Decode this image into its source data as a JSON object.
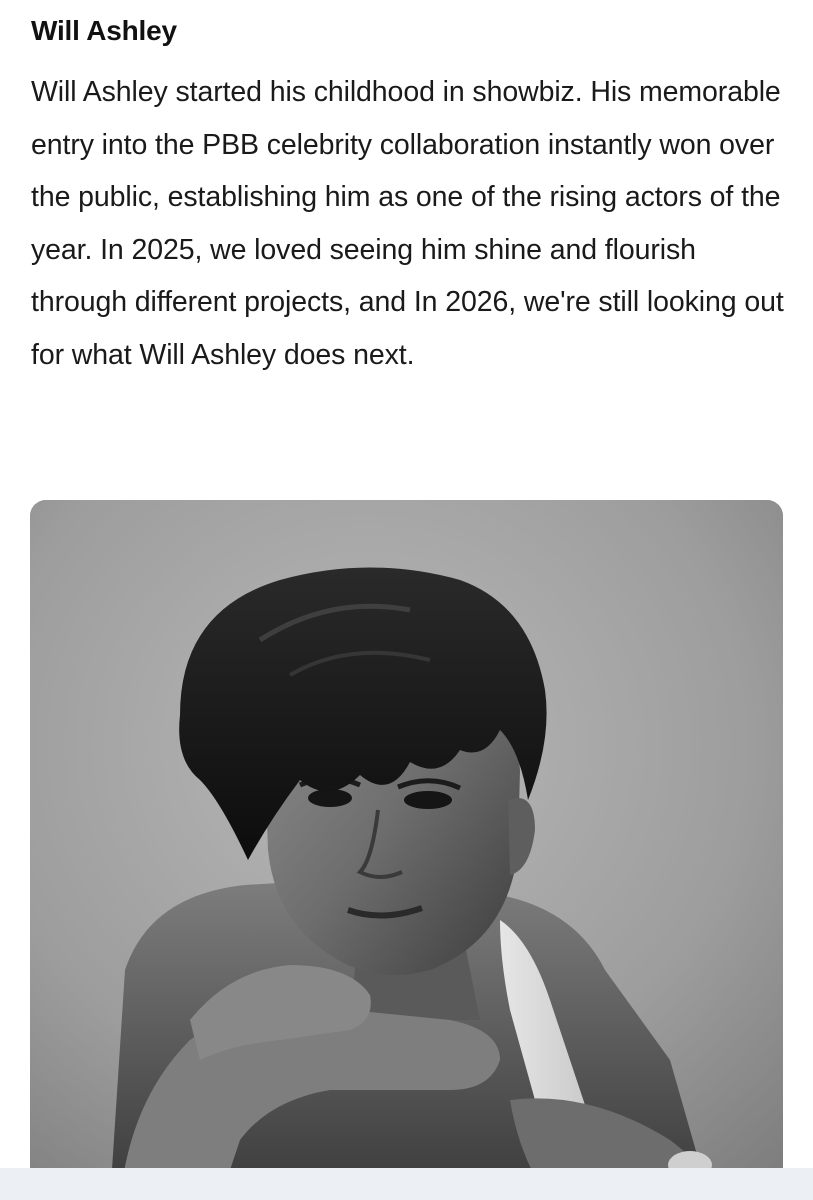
{
  "article": {
    "title": "Will Ashley",
    "body": "Will Ashley started his childhood in showbiz. His memorable entry into the PBB celebrity collaboration instantly won over the public, establishing him as one of the rising actors of the year. In 2025, we loved seeing him shine and flourish through different projects, and In 2026, we're still looking out for what Will Ashley does next."
  },
  "photo": {
    "style": "black-and-white portrait",
    "subject": "Will Ashley"
  }
}
